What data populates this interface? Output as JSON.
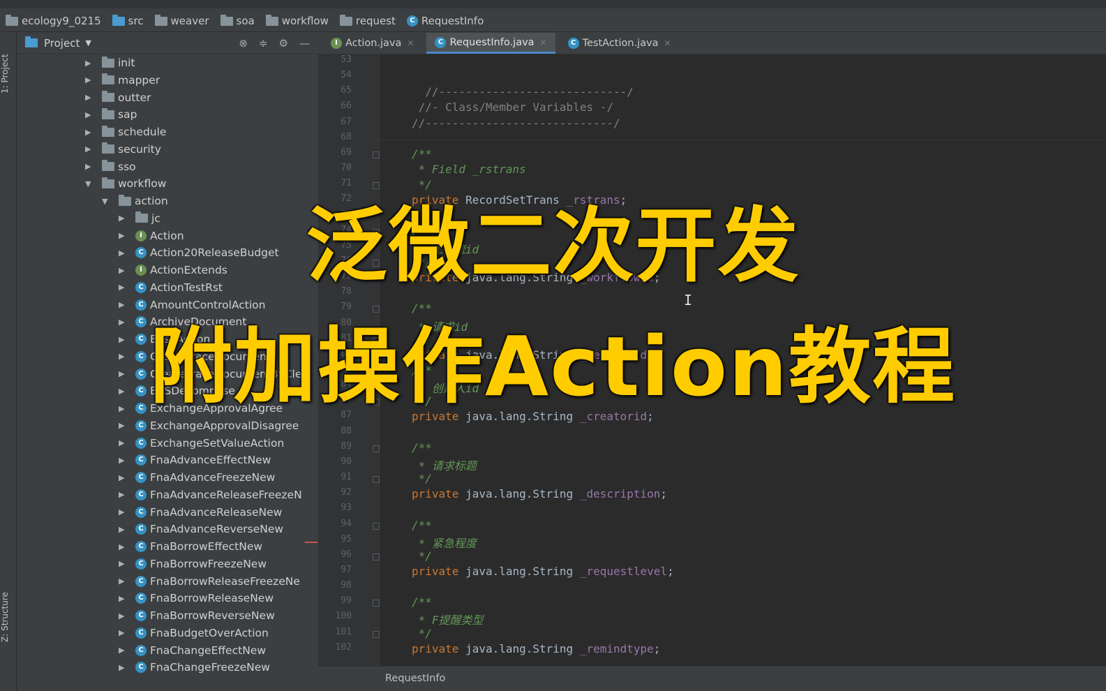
{
  "breadcrumb": [
    "ecology9_0215",
    "src",
    "weaver",
    "soa",
    "workflow",
    "request",
    "RequestInfo"
  ],
  "left_stripe": {
    "project_tab": "1: Project",
    "structure_tab": "Z: Structure"
  },
  "project_panel": {
    "title": "Project",
    "dropdown_icon": "chevron-down-icon"
  },
  "tree": [
    {
      "label": "init",
      "kind": "folder",
      "expanded": false,
      "depth": 0
    },
    {
      "label": "mapper",
      "kind": "folder",
      "expanded": false,
      "depth": 0
    },
    {
      "label": "outter",
      "kind": "folder",
      "expanded": false,
      "depth": 0
    },
    {
      "label": "sap",
      "kind": "folder",
      "expanded": false,
      "depth": 0
    },
    {
      "label": "schedule",
      "kind": "folder",
      "expanded": false,
      "depth": 0
    },
    {
      "label": "security",
      "kind": "folder",
      "expanded": false,
      "depth": 0
    },
    {
      "label": "sso",
      "kind": "folder",
      "expanded": false,
      "depth": 0
    },
    {
      "label": "workflow",
      "kind": "folder",
      "expanded": true,
      "depth": 0
    },
    {
      "label": "action",
      "kind": "folder",
      "expanded": true,
      "depth": 1
    },
    {
      "label": "jc",
      "kind": "folder",
      "expanded": false,
      "depth": 2
    },
    {
      "label": "Action",
      "kind": "interface",
      "expanded": false,
      "depth": 2
    },
    {
      "label": "Action20ReleaseBudget",
      "kind": "class",
      "expanded": false,
      "depth": 2
    },
    {
      "label": "ActionExtends",
      "kind": "interface",
      "expanded": false,
      "depth": 2
    },
    {
      "label": "ActionTestRst",
      "kind": "class",
      "expanded": false,
      "depth": 2
    },
    {
      "label": "AmountControlAction",
      "kind": "class",
      "expanded": false,
      "depth": 2
    },
    {
      "label": "ArchiveDocument",
      "kind": "class",
      "expanded": false,
      "depth": 2
    },
    {
      "label": "BaseAction",
      "kind": "class",
      "expanded": false,
      "depth": 2
    },
    {
      "label": "CreateTraceDocument",
      "kind": "class",
      "expanded": false,
      "depth": 2
    },
    {
      "label": "CreateTraceDocumentByCle",
      "kind": "class",
      "expanded": false,
      "depth": 2
    },
    {
      "label": "EASDecompose",
      "kind": "class",
      "expanded": false,
      "depth": 2
    },
    {
      "label": "ExchangeApprovalAgree",
      "kind": "class",
      "expanded": false,
      "depth": 2
    },
    {
      "label": "ExchangeApprovalDisagree",
      "kind": "class",
      "expanded": false,
      "depth": 2
    },
    {
      "label": "ExchangeSetValueAction",
      "kind": "class",
      "expanded": false,
      "depth": 2
    },
    {
      "label": "FnaAdvanceEffectNew",
      "kind": "class",
      "expanded": false,
      "depth": 2
    },
    {
      "label": "FnaAdvanceFreezeNew",
      "kind": "class",
      "expanded": false,
      "depth": 2
    },
    {
      "label": "FnaAdvanceReleaseFreezeN",
      "kind": "class",
      "expanded": false,
      "depth": 2
    },
    {
      "label": "FnaAdvanceReleaseNew",
      "kind": "class",
      "expanded": false,
      "depth": 2
    },
    {
      "label": "FnaAdvanceReverseNew",
      "kind": "class",
      "expanded": false,
      "depth": 2
    },
    {
      "label": "FnaBorrowEffectNew",
      "kind": "class",
      "expanded": false,
      "depth": 2
    },
    {
      "label": "FnaBorrowFreezeNew",
      "kind": "class",
      "expanded": false,
      "depth": 2
    },
    {
      "label": "FnaBorrowReleaseFreezeNe",
      "kind": "class",
      "expanded": false,
      "depth": 2
    },
    {
      "label": "FnaBorrowReleaseNew",
      "kind": "class",
      "expanded": false,
      "depth": 2
    },
    {
      "label": "FnaBorrowReverseNew",
      "kind": "class",
      "expanded": false,
      "depth": 2
    },
    {
      "label": "FnaBudgetOverAction",
      "kind": "class",
      "expanded": false,
      "depth": 2
    },
    {
      "label": "FnaChangeEffectNew",
      "kind": "class",
      "expanded": false,
      "depth": 2
    },
    {
      "label": "FnaChangeFreezeNew",
      "kind": "class",
      "expanded": false,
      "depth": 2
    }
  ],
  "tabs": [
    {
      "label": "Action.java",
      "kind": "interface",
      "active": false
    },
    {
      "label": "RequestInfo.java",
      "kind": "class",
      "active": true
    },
    {
      "label": "TestAction.java",
      "kind": "class",
      "active": false
    }
  ],
  "code_lines": [
    {
      "n": "53",
      "parts": []
    },
    {
      "n": "54",
      "parts": []
    },
    {
      "n": "65",
      "parts": [
        {
          "t": "  //----------------------------/",
          "c": "cm"
        }
      ]
    },
    {
      "n": "66",
      "parts": [
        {
          "t": " //- Class/Member Variables -/",
          "c": "cm"
        }
      ]
    },
    {
      "n": "67",
      "parts": [
        {
          "t": "//----------------------------/",
          "c": "cm"
        }
      ]
    },
    {
      "n": "68",
      "parts": []
    },
    {
      "n": "69",
      "parts": [
        {
          "t": "/**",
          "c": "doc"
        }
      ]
    },
    {
      "n": "70",
      "parts": [
        {
          "t": " * Field _rstrans",
          "c": "doc"
        }
      ]
    },
    {
      "n": "71",
      "parts": [
        {
          "t": " */",
          "c": "doc"
        }
      ]
    },
    {
      "n": "72",
      "parts": [
        {
          "t": "private ",
          "c": "kw"
        },
        {
          "t": "RecordSetTrans ",
          "c": "tx"
        },
        {
          "t": "_rstrans",
          "c": "fld"
        },
        {
          "t": ";",
          "c": "tx"
        }
      ]
    },
    {
      "n": "73",
      "parts": []
    },
    {
      "n": "74",
      "parts": [
        {
          "t": "/**",
          "c": "doc"
        }
      ]
    },
    {
      "n": "75",
      "parts": [
        {
          "t": " * 工作流id",
          "c": "doc"
        }
      ]
    },
    {
      "n": "76",
      "parts": [
        {
          "t": " */",
          "c": "doc"
        }
      ]
    },
    {
      "n": "77",
      "parts": [
        {
          "t": "private ",
          "c": "kw"
        },
        {
          "t": "java.lang.String ",
          "c": "tx"
        },
        {
          "t": "_workflowid",
          "c": "fld"
        },
        {
          "t": ";",
          "c": "tx"
        }
      ]
    },
    {
      "n": "78",
      "parts": []
    },
    {
      "n": "79",
      "parts": [
        {
          "t": "/**",
          "c": "doc"
        }
      ]
    },
    {
      "n": "80",
      "parts": [
        {
          "t": " * 请求id",
          "c": "doc"
        }
      ]
    },
    {
      "n": "81",
      "parts": [
        {
          "t": " */",
          "c": "doc"
        }
      ]
    },
    {
      "n": "82",
      "parts": [
        {
          "t": "private ",
          "c": "kw"
        },
        {
          "t": "java.lang.String ",
          "c": "tx"
        },
        {
          "t": "_requestid",
          "c": "fld"
        },
        {
          "t": ";",
          "c": "tx"
        }
      ]
    },
    {
      "n": "83",
      "parts": [
        {
          "t": "/**",
          "c": "doc"
        }
      ]
    },
    {
      "n": "84",
      "parts": [
        {
          "t": " * 创建人id",
          "c": "doc"
        }
      ]
    },
    {
      "n": "86",
      "parts": [
        {
          "t": " */",
          "c": "doc"
        }
      ]
    },
    {
      "n": "87",
      "parts": [
        {
          "t": "private ",
          "c": "kw"
        },
        {
          "t": "java.lang.String ",
          "c": "tx"
        },
        {
          "t": "_creatorid",
          "c": "fld"
        },
        {
          "t": ";",
          "c": "tx"
        }
      ]
    },
    {
      "n": "88",
      "parts": []
    },
    {
      "n": "89",
      "parts": [
        {
          "t": "/**",
          "c": "doc"
        }
      ]
    },
    {
      "n": "90",
      "parts": [
        {
          "t": " * 请求标题",
          "c": "doc"
        }
      ]
    },
    {
      "n": "91",
      "parts": [
        {
          "t": " */",
          "c": "doc"
        }
      ]
    },
    {
      "n": "92",
      "parts": [
        {
          "t": "private ",
          "c": "kw"
        },
        {
          "t": "java.lang.String ",
          "c": "tx"
        },
        {
          "t": "_description",
          "c": "fld"
        },
        {
          "t": ";",
          "c": "tx"
        }
      ]
    },
    {
      "n": "93",
      "parts": []
    },
    {
      "n": "94",
      "parts": [
        {
          "t": "/**",
          "c": "doc"
        }
      ]
    },
    {
      "n": "95",
      "parts": [
        {
          "t": " * 紧急程度",
          "c": "doc"
        }
      ]
    },
    {
      "n": "96",
      "parts": [
        {
          "t": " */",
          "c": "doc"
        }
      ]
    },
    {
      "n": "97",
      "parts": [
        {
          "t": "private ",
          "c": "kw"
        },
        {
          "t": "java.lang.String ",
          "c": "tx"
        },
        {
          "t": "_requestlevel",
          "c": "fld"
        },
        {
          "t": ";",
          "c": "tx"
        }
      ]
    },
    {
      "n": "98",
      "parts": []
    },
    {
      "n": "99",
      "parts": [
        {
          "t": "/**",
          "c": "doc"
        }
      ]
    },
    {
      "n": "100",
      "parts": [
        {
          "t": " * F提醒类型",
          "c": "doc"
        }
      ]
    },
    {
      "n": "101",
      "parts": [
        {
          "t": " */",
          "c": "doc"
        }
      ]
    },
    {
      "n": "102",
      "parts": [
        {
          "t": "private ",
          "c": "kw"
        },
        {
          "t": "java.lang.String ",
          "c": "tx"
        },
        {
          "t": "_remindtype",
          "c": "fld"
        },
        {
          "t": ";",
          "c": "tx"
        }
      ]
    }
  ],
  "status_breadcrumb": "RequestInfo",
  "overlay": {
    "line1": "泛微二次开发",
    "line2": "附加操作Action教程"
  },
  "colors": {
    "overlay_text": "#ffcc00",
    "keyword": "#cc7832",
    "doc_comment": "#629755",
    "field": "#9876aa",
    "active_tab_underline": "#4a88c7"
  }
}
